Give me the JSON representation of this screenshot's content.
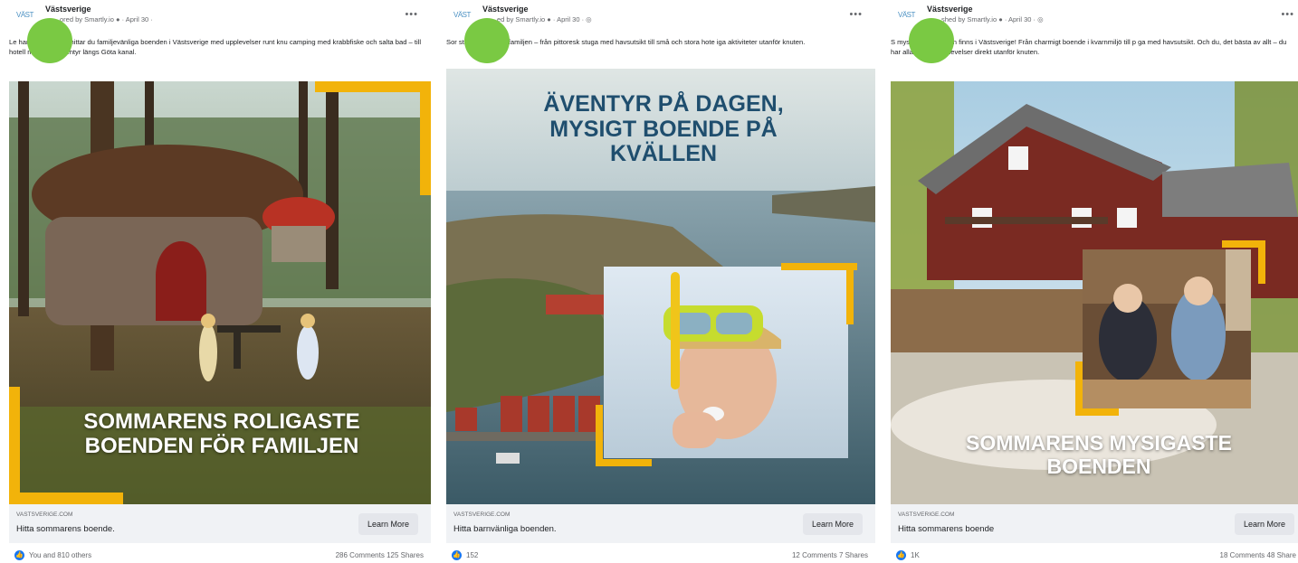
{
  "colors": {
    "accent_yellow": "#f2b30a",
    "facebook_blue": "#1877f2",
    "headline_blue": "#1f4e6e",
    "avatar_green": "#7ac943"
  },
  "posts": [
    {
      "page_name": "Västsverige",
      "byline": "ored by Smartly.io ● · April 30 ·",
      "caption": "Le                harboende? Här hittar du familjevänliga boenden i Västsverige med upplevelser runt knu          camping med krabbfiske och salta bad – till hotell med cykeläventyr längs Göta kanal.",
      "headline": "SOMMARENS ROLIGASTE BOENDEN FÖR FAMILJEN",
      "domain": "VASTSVERIGE.COM",
      "link_title": "Hitta sommarens boende.",
      "button": "Learn More",
      "reactions": "You and 810 others",
      "stats": "286 Comments  125 Shares"
    },
    {
      "page_name": "Västsverige",
      "byline": "ed by Smartly.io ● · April 30 · ◎",
      "caption": "Sor            sta boenden för familjen – från pittoresk stuga med havsutsikt till små och stora hote           iga aktiviteter utanför knuten.",
      "headline": "ÄVENTYR PÅ DAGEN, MYSIGT BOENDE PÅ KVÄLLEN",
      "domain": "VASTSVERIGE.COM",
      "link_title": "Hitta barnvänliga boenden.",
      "button": "Learn More",
      "reactions": "152",
      "stats": "12 Comments  7 Shares"
    },
    {
      "page_name": "Västsverige",
      "byline": "shed by Smartly.io ● · April 30 · ◎",
      "caption": "S              mysigaste boenden finns i Västsverige! Från charmigt boende i kvarnmiljö till p             ga med havsutsikt. Och du, det bästa av allt – du har alla härliga upplevelser direkt utanför knuten.",
      "headline": "SOMMARENS MYSIGASTE BOENDEN",
      "domain": "VASTSVERIGE.COM",
      "link_title": "Hitta sommarens boende",
      "button": "Learn More",
      "reactions": "1K",
      "stats": "18 Comments  48 Share"
    }
  ]
}
